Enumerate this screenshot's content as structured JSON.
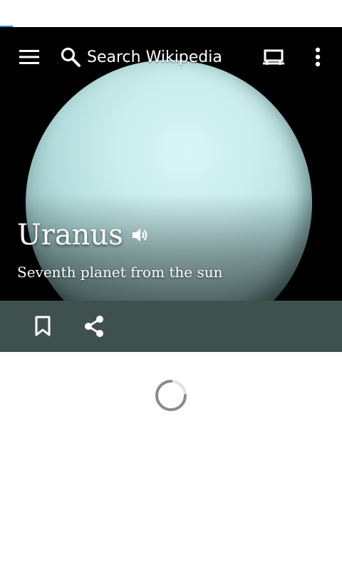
{
  "toolbar": {
    "search_placeholder": "Search Wikipedia",
    "icons": {
      "menu": "menu-icon",
      "search": "search-icon",
      "reading_lists": "reading-list-icon",
      "overflow": "more-vert-icon"
    }
  },
  "article": {
    "title": "Uranus",
    "description": "Seventh planet from the sun"
  },
  "actions": {
    "icons": {
      "bookmark": "bookmark-icon",
      "share": "share-icon",
      "audio": "volume-icon"
    }
  },
  "colors": {
    "action_bar": "#3f514d",
    "hero_background": "#000000",
    "planet": "#c9ecec",
    "progress": "#2f8fd8",
    "spinner": "#8a8a8a"
  },
  "loading": {
    "visible": true
  }
}
